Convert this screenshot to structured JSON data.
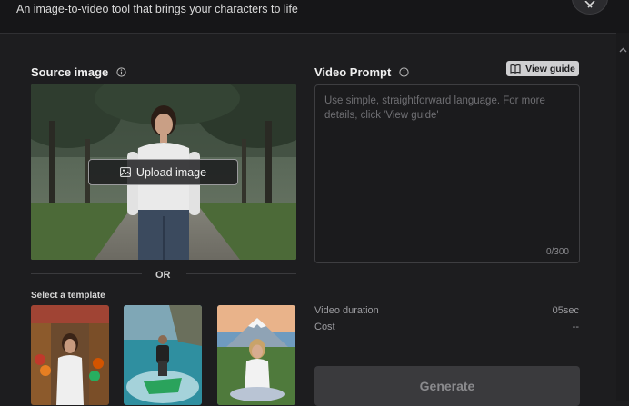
{
  "header": {
    "subtitle": "An image-to-video tool that brings your characters to life"
  },
  "source": {
    "label": "Source image",
    "upload_label": "Upload image",
    "or_text": "OR",
    "template_label": "Select a template"
  },
  "templates": [
    {
      "name": "market-woman"
    },
    {
      "name": "jet-ski-rider"
    },
    {
      "name": "mountain-woman"
    }
  ],
  "prompt": {
    "label": "Video Prompt",
    "guide_label": "View guide",
    "placeholder": "Use simple, straightforward language. For more details, click 'View guide'",
    "value": "",
    "counter": "0/300"
  },
  "settings": {
    "duration_label": "Video duration",
    "duration_value": "05sec",
    "cost_label": "Cost",
    "cost_value": "--"
  },
  "actions": {
    "generate_label": "Generate"
  },
  "icons": {
    "close": "close-icon",
    "scroll_up": "chevron-up-icon",
    "info": "info-icon",
    "upload": "image-icon",
    "guide": "book-icon"
  }
}
